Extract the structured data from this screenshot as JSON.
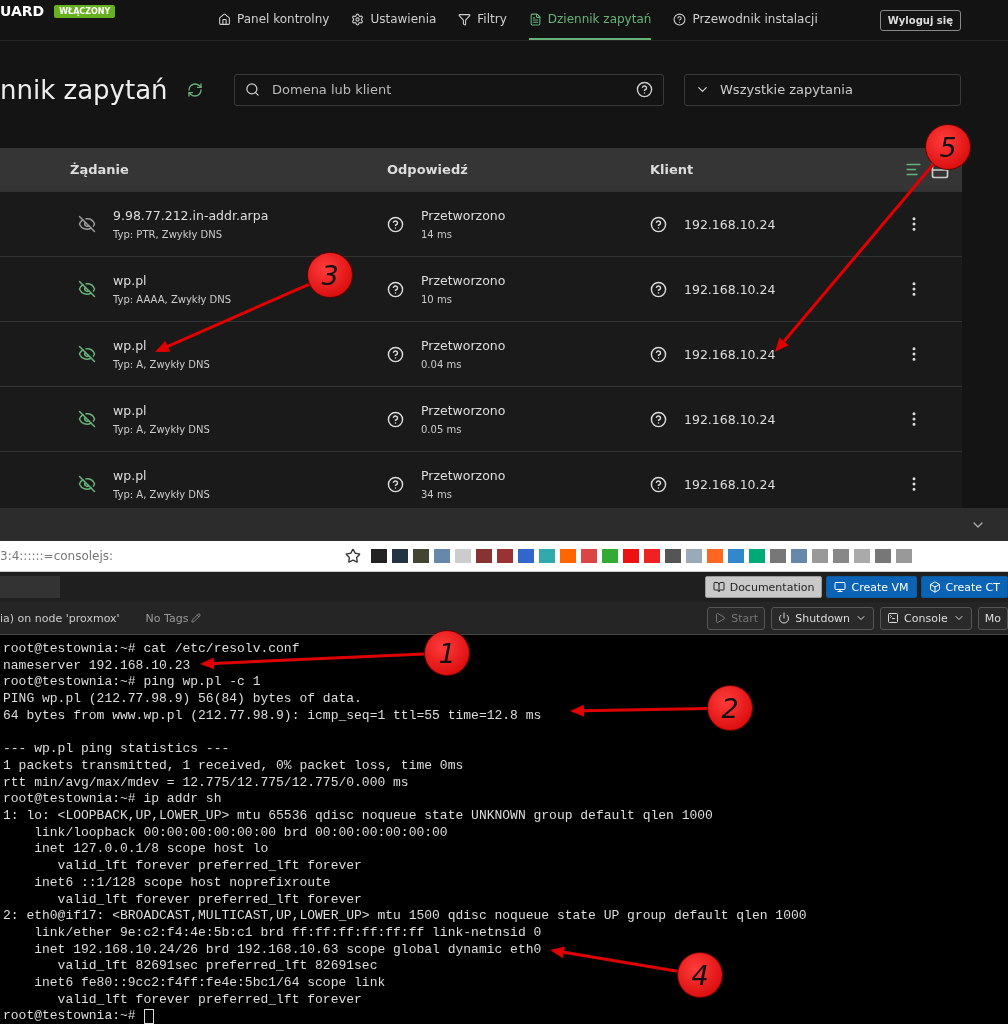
{
  "nav": {
    "brand": "UARD",
    "status_badge": "WŁĄCZONY",
    "items": [
      {
        "label": "Panel kontrolny",
        "selected": false
      },
      {
        "label": "Ustawienia",
        "selected": false
      },
      {
        "label": "Filtry",
        "selected": false
      },
      {
        "label": "Dziennik zapytań",
        "selected": true
      },
      {
        "label": "Przewodnik instalacji",
        "selected": false
      }
    ],
    "logout": "Wyloguj się"
  },
  "header": {
    "title": "nnik zapytań",
    "search": {
      "placeholder": "Domena lub klient"
    },
    "filter": {
      "value": "Wszystkie zapytania"
    }
  },
  "table": {
    "columns": [
      "Żądanie",
      "Odpowiedź",
      "Klient"
    ],
    "rows": [
      {
        "domain": "9.98.77.212.in-addr.arpa",
        "type": "Typ: PTR, Zwykły DNS",
        "status": "Przetworzono",
        "time": "14 ms",
        "client": "192.168.10.24",
        "color": "#9a9a9a"
      },
      {
        "domain": "wp.pl",
        "type": "Typ: AAAA, Zwykły DNS",
        "status": "Przetworzono",
        "time": "10 ms",
        "client": "192.168.10.24",
        "color": "#67b279"
      },
      {
        "domain": "wp.pl",
        "type": "Typ: A, Zwykły DNS",
        "status": "Przetworzono",
        "time": "0.04 ms",
        "client": "192.168.10.24",
        "color": "#67b279"
      },
      {
        "domain": "wp.pl",
        "type": "Typ: A, Zwykły DNS",
        "status": "Przetworzono",
        "time": "0.05 ms",
        "client": "192.168.10.24",
        "color": "#67b279"
      },
      {
        "domain": "wp.pl",
        "type": "Typ: A, Zwykły DNS",
        "status": "Przetworzono",
        "time": "34 ms",
        "client": "192.168.10.24",
        "color": "#67b279"
      }
    ]
  },
  "browser": {
    "url": "3:4::::::=consolejs:"
  },
  "proxmox": {
    "buttons": [
      "Documentation",
      "Create VM",
      "Create CT"
    ],
    "vm_title": "ia) on node 'proxmox'",
    "tags": "No Tags",
    "actions": [
      {
        "label": "Start",
        "disabled": true,
        "dropdown": false
      },
      {
        "label": "Shutdown",
        "disabled": false,
        "dropdown": true
      },
      {
        "label": "Console",
        "disabled": false,
        "dropdown": true
      },
      {
        "label": "Mo",
        "disabled": false,
        "dropdown": false
      }
    ]
  },
  "terminal": {
    "blocks": [
      [
        "root@testownia:~# cat /etc/resolv.conf",
        "nameserver 192.168.10.23",
        "root@testownia:~# ping wp.pl -c 1",
        "PING wp.pl (212.77.98.9) 56(84) bytes of data.",
        "64 bytes from www.wp.pl (212.77.98.9): icmp_seq=1 ttl=55 time=12.8 ms"
      ],
      [
        "--- wp.pl ping statistics ---",
        "1 packets transmitted, 1 received, 0% packet loss, time 0ms",
        "rtt min/avg/max/mdev = 12.775/12.775/12.775/0.000 ms",
        "root@testownia:~# ip addr sh",
        "1: lo: <LOOPBACK,UP,LOWER_UP> mtu 65536 qdisc noqueue state UNKNOWN group default qlen 1000",
        "    link/loopback 00:00:00:00:00:00 brd 00:00:00:00:00:00",
        "    inet 127.0.0.1/8 scope host lo",
        "       valid_lft forever preferred_lft forever",
        "    inet6 ::1/128 scope host noprefixroute",
        "       valid_lft forever preferred_lft forever",
        "2: eth0@if17: <BROADCAST,MULTICAST,UP,LOWER_UP> mtu 1500 qdisc noqueue state UP group default qlen 1000",
        "    link/ether 9e:c2:f4:4e:5b:c1 brd ff:ff:ff:ff:ff:ff link-netnsid 0",
        "    inet 192.168.10.24/26 brd 192.168.10.63 scope global dynamic eth0",
        "       valid_lft 82691sec preferred_lft 82691sec",
        "    inet6 fe80::9cc2:f4ff:fe4e:5bc1/64 scope link",
        "       valid_lft forever preferred_lft forever",
        "root@testownia:~#"
      ]
    ]
  },
  "annotations": [
    {
      "label": "1"
    },
    {
      "label": "2"
    },
    {
      "label": "3"
    },
    {
      "label": "4"
    },
    {
      "label": "5"
    }
  ]
}
